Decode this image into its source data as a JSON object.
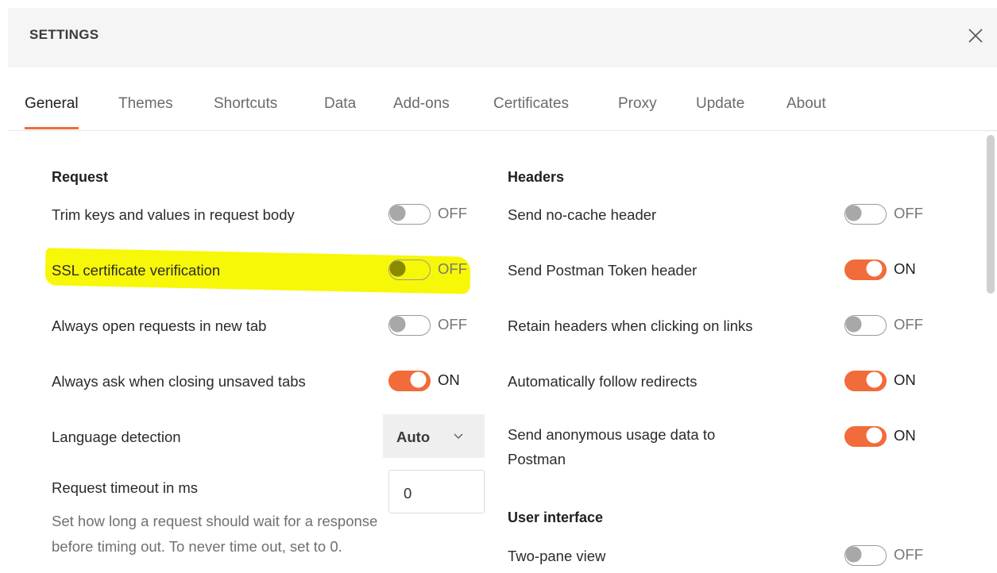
{
  "header": {
    "title": "SETTINGS"
  },
  "tabs": [
    "General",
    "Themes",
    "Shortcuts",
    "Data",
    "Add-ons",
    "Certificates",
    "Proxy",
    "Update",
    "About"
  ],
  "request": {
    "title": "Request",
    "trim": {
      "label": "Trim keys and values in request body",
      "state": "OFF"
    },
    "ssl": {
      "label": "SSL certificate verification",
      "state": "OFF"
    },
    "new_tab": {
      "label": "Always open requests in new tab",
      "state": "OFF"
    },
    "ask_close": {
      "label": "Always ask when closing unsaved tabs",
      "state": "ON"
    },
    "language": {
      "label": "Language detection",
      "value": "Auto"
    },
    "timeout": {
      "label": "Request timeout in ms",
      "value": "0",
      "description": "Set how long a request should wait for a response before timing out. To never time out, set to 0."
    }
  },
  "headers": {
    "title": "Headers",
    "no_cache": {
      "label": "Send no-cache header",
      "state": "OFF"
    },
    "postman_token": {
      "label": "Send Postman Token header",
      "state": "ON"
    },
    "retain": {
      "label": "Retain headers when clicking on links",
      "state": "OFF"
    },
    "redirects": {
      "label": "Automatically follow redirects",
      "state": "ON"
    },
    "anon_line1": "Send anonymous usage data to",
    "anon_line2": "Postman",
    "anon_state": "ON"
  },
  "ui": {
    "title": "User interface",
    "two_pane": {
      "label": "Two-pane view",
      "state": "OFF"
    }
  },
  "colors": {
    "accent": "#f26b3a",
    "highlight": "#f7f700"
  }
}
